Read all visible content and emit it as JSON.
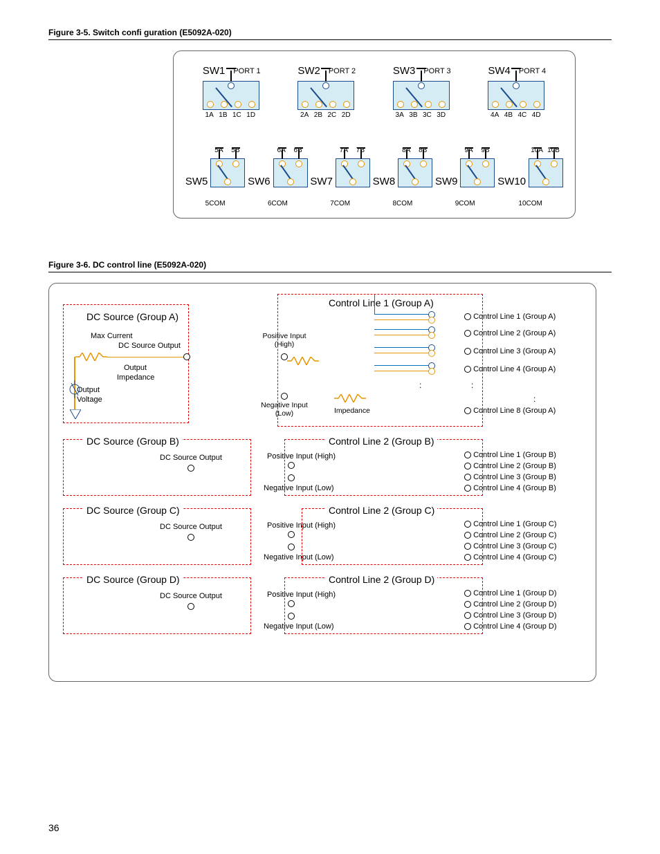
{
  "page_number": "36",
  "fig35": {
    "title": "Figure 3-5. Switch confi guration (E5092A-020)",
    "top_switches": [
      {
        "sw": "SW1",
        "port": "PORT 1",
        "outs": [
          "1A",
          "1B",
          "1C",
          "1D"
        ]
      },
      {
        "sw": "SW2",
        "port": "PORT 2",
        "outs": [
          "2A",
          "2B",
          "2C",
          "2D"
        ]
      },
      {
        "sw": "SW3",
        "port": "PORT 3",
        "outs": [
          "3A",
          "3B",
          "3C",
          "3D"
        ]
      },
      {
        "sw": "SW4",
        "port": "PORT 4",
        "outs": [
          "4A",
          "4B",
          "4C",
          "4D"
        ]
      }
    ],
    "bottom_switches": [
      {
        "sw": "SW5",
        "ab": [
          "5A",
          "5B"
        ],
        "com": "5COM"
      },
      {
        "sw": "SW6",
        "ab": [
          "6A",
          "6B"
        ],
        "com": "6COM"
      },
      {
        "sw": "SW7",
        "ab": [
          "7A",
          "7B"
        ],
        "com": "7COM"
      },
      {
        "sw": "SW8",
        "ab": [
          "8A",
          "8B"
        ],
        "com": "8COM"
      },
      {
        "sw": "SW9",
        "ab": [
          "9A",
          "9B"
        ],
        "com": "9COM"
      },
      {
        "sw": "SW10",
        "ab": [
          "10A",
          "10B"
        ],
        "com": "10COM"
      }
    ]
  },
  "fig36": {
    "title": "Figure 3-6. DC control line (E5092A-020)",
    "groupA": {
      "dc_hdr": "DC Source (Group A)",
      "cl_hdr": "Control Line 1 (Group A)",
      "max_current": "Max Current",
      "dc_source_output": "DC Source Output",
      "output": "Output",
      "impedance": "Impedance",
      "output_voltage_a": "Output",
      "output_voltage_b": "Voltage",
      "pos_hi_a": "Positive Input",
      "pos_hi_b": "(High)",
      "neg_lo_a": "Negative Input",
      "neg_lo_b": "(Low)",
      "impedance2": "Impedance",
      "lines": [
        "Control Line 1 (Group A)",
        "Control Line 2 (Group A)",
        "Control Line 3 (Group A)",
        "Control Line 4 (Group A)",
        "Control Line 8 (Group A)"
      ]
    },
    "groupB": {
      "dc_hdr": "DC Source (Group B)",
      "cl_hdr": "Control Line 2 (Group B)",
      "dc_source_output": "DC Source Output",
      "pos_hi": "Positive Input (High)",
      "neg_lo": "Negative Input (Low)",
      "lines": [
        "Control Line 1 (Group B)",
        "Control Line 2 (Group B)",
        "Control Line 3 (Group B)",
        "Control Line 4 (Group B)"
      ]
    },
    "groupC": {
      "dc_hdr": "DC Source (Group C)",
      "cl_hdr": "Control Line 2 (Group C)",
      "dc_source_output": "DC Source Output",
      "pos_hi": "Positive Input (High)",
      "neg_lo": "Negative Input (Low)",
      "lines": [
        "Control Line 1 (Group C)",
        "Control Line 2 (Group C)",
        "Control Line 3 (Group C)",
        "Control Line 4 (Group C)"
      ]
    },
    "groupD": {
      "dc_hdr": "DC Source (Group D)",
      "cl_hdr": "Control Line 2 (Group D)",
      "dc_source_output": "DC Source Output",
      "pos_hi": "Positive Input (High)",
      "neg_lo": "Negative Input (Low)",
      "lines": [
        "Control Line 1 (Group D)",
        "Control Line 2 (Group D)",
        "Control Line 3 (Group D)",
        "Control Line 4 (Group D)"
      ]
    }
  }
}
